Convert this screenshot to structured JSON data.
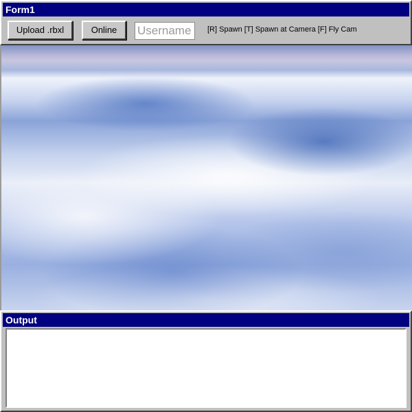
{
  "form": {
    "title": "Form1",
    "upload_button_label": "Upload .rbxl",
    "online_button_label": "Online",
    "username_placeholder": "Username",
    "username_value": "",
    "controls_hint": "[R] Spawn [T] Spawn at Camera [F] Fly Cam"
  },
  "output": {
    "title": "Output",
    "text": ""
  },
  "colors": {
    "titlebar": "#000080",
    "panel": "#c0c0c0"
  }
}
